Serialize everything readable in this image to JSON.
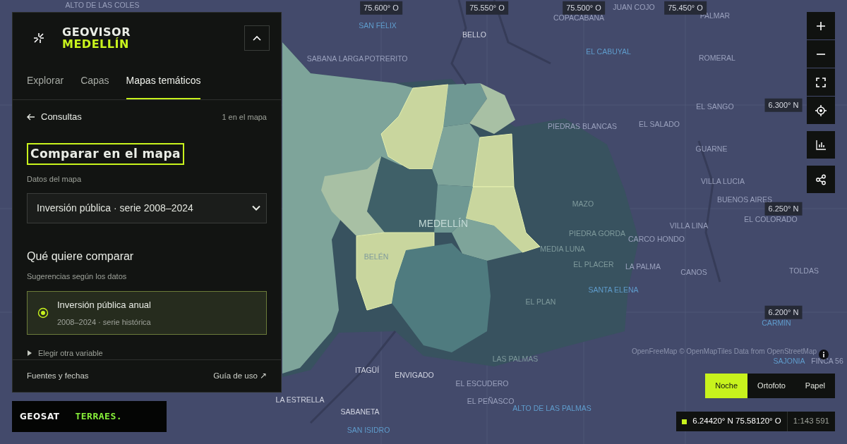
{
  "panel": {
    "logo": {
      "line1": "GEOVISOR",
      "line2": "MEDELLÍN"
    },
    "tabs": [
      {
        "label": "Explorar",
        "selected": false
      },
      {
        "label": "Capas",
        "selected": false
      },
      {
        "label": "Mapas temáticos",
        "selected": true
      }
    ],
    "back_link": "Consultas",
    "count": "1 en el mapa",
    "heading": "Comparar en el mapa",
    "data_label": "Datos del mapa",
    "data_select": "Inversión pública · serie 2008–2024",
    "compare_title": "Qué quiere comparar",
    "compare_subtitle": "Sugerencias según los datos",
    "options": [
      {
        "title": "Inversión pública anual",
        "subtitle": "2008–2024 · serie histórica",
        "selected": true
      }
    ],
    "expander": {
      "label": "Elegir otra variable",
      "expanded": false
    },
    "footer": {
      "sources": "Fuentes y fechas",
      "guide": "Guía de uso ↗"
    }
  },
  "partners": [
    "GEOSAT",
    "TERRAES."
  ],
  "map": {
    "lon_ticks": [
      "75.600° O",
      "75.550° O",
      "75.500° O",
      "75.450° O"
    ],
    "lat_ticks": [
      "6.300° N",
      "6.250° N",
      "6.200° N"
    ],
    "places": [
      {
        "name": "ALTO DE LAS COLES",
        "kind": "plain"
      },
      {
        "name": "SAN FÉLIX",
        "kind": "water"
      },
      {
        "name": "BELLO",
        "kind": "city"
      },
      {
        "name": "COPACABANA",
        "kind": "plain"
      },
      {
        "name": "JUAN COJO",
        "kind": "plain"
      },
      {
        "name": "PALMAR",
        "kind": "plain"
      },
      {
        "name": "SABANA LARGA",
        "kind": "plain"
      },
      {
        "name": "POTRERITO",
        "kind": "plain"
      },
      {
        "name": "EL CABUYAL",
        "kind": "water"
      },
      {
        "name": "ROMERAL",
        "kind": "plain"
      },
      {
        "name": "EL SANGO",
        "kind": "plain"
      },
      {
        "name": "EL SALADO",
        "kind": "plain"
      },
      {
        "name": "PIEDRAS BLANCAS",
        "kind": "plain"
      },
      {
        "name": "GUARNE",
        "kind": "plain"
      },
      {
        "name": "VILLA LUCIA",
        "kind": "plain"
      },
      {
        "name": "BUENOS AIRES",
        "kind": "plain"
      },
      {
        "name": "EL COLORADO",
        "kind": "plain"
      },
      {
        "name": "MAZO",
        "kind": "faint"
      },
      {
        "name": "VILLA LINA",
        "kind": "plain"
      },
      {
        "name": "PIEDRA GORDA",
        "kind": "faint"
      },
      {
        "name": "CARCO HONDO",
        "kind": "plain"
      },
      {
        "name": "MEDIA LUNA",
        "kind": "faint"
      },
      {
        "name": "EL PLACER",
        "kind": "faint"
      },
      {
        "name": "LA PALMA",
        "kind": "plain"
      },
      {
        "name": "CANOS",
        "kind": "plain"
      },
      {
        "name": "TOLDAS",
        "kind": "plain"
      },
      {
        "name": "SANTA ELENA",
        "kind": "water"
      },
      {
        "name": "MEDELLÍN",
        "kind": "big"
      },
      {
        "name": "BELÉN",
        "kind": "faint"
      },
      {
        "name": "EL PLAN",
        "kind": "faint"
      },
      {
        "name": "CARMÍN",
        "kind": "water"
      },
      {
        "name": "LAS PALMAS",
        "kind": "faint"
      },
      {
        "name": "SAJONIA",
        "kind": "water"
      },
      {
        "name": "FINCA 56",
        "kind": "plain"
      },
      {
        "name": "ITAGÜÍ",
        "kind": "city"
      },
      {
        "name": "ENVIGADO",
        "kind": "city"
      },
      {
        "name": "EL ESCUDERO",
        "kind": "plain"
      },
      {
        "name": "EL PEÑASCO",
        "kind": "plain"
      },
      {
        "name": "ALTO DE LAS PALMAS",
        "kind": "water"
      },
      {
        "name": "LA ESTRELLA",
        "kind": "city"
      },
      {
        "name": "SABANETA",
        "kind": "city"
      },
      {
        "name": "SAN ISIDRO",
        "kind": "water"
      }
    ],
    "attribution": "OpenFreeMap © OpenMapTiles Data from OpenStreetMap",
    "basemaps": [
      {
        "label": "Noche",
        "selected": true
      },
      {
        "label": "Ortofoto",
        "selected": false
      },
      {
        "label": "Papel",
        "selected": false
      }
    ],
    "readout": {
      "coords": "6.24420° N 75.58120° O",
      "scale": "1:143 591"
    }
  }
}
